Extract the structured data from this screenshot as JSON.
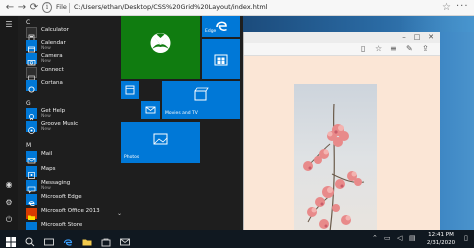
{
  "browser": {
    "back": "←",
    "forward": "→",
    "reload": "⟳",
    "info": "i",
    "file_label": "File",
    "url": "C:/Users/ethan/Desktop/CSS%20Grid%20Layout/index.html"
  },
  "start_menu": {
    "sections": [
      {
        "letter": "C",
        "apps": [
          {
            "name": "Calculator",
            "sub": ""
          },
          {
            "name": "Calendar",
            "sub": "New"
          },
          {
            "name": "Camera",
            "sub": "New"
          },
          {
            "name": "Connect",
            "sub": ""
          },
          {
            "name": "Cortana",
            "sub": ""
          }
        ]
      },
      {
        "letter": "G",
        "apps": [
          {
            "name": "Get Help",
            "sub": "New"
          },
          {
            "name": "Groove Music",
            "sub": "New"
          }
        ]
      },
      {
        "letter": "M",
        "apps": [
          {
            "name": "Mail",
            "sub": ""
          },
          {
            "name": "Maps",
            "sub": ""
          },
          {
            "name": "Messaging",
            "sub": "New"
          },
          {
            "name": "Microsoft Edge",
            "sub": ""
          },
          {
            "name": "Microsoft Office 2013",
            "sub": ""
          },
          {
            "name": "Microsoft Store",
            "sub": ""
          }
        ]
      }
    ],
    "tiles": {
      "edge": "Edge",
      "movies": "Movies and TV",
      "photos": "Photos"
    }
  },
  "taskbar": {
    "time": "12:41 PM",
    "date": "2/31/2020"
  },
  "colors": {
    "tile_blue": "#0078d7",
    "xbox_green": "#107c10",
    "start_bg": "#1e1e1e"
  }
}
